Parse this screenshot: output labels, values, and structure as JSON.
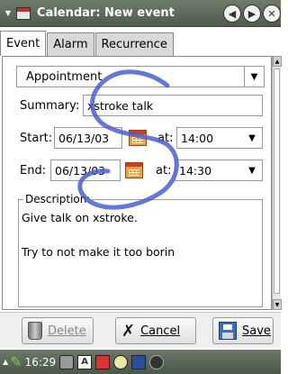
{
  "window": {
    "title": "Calendar: New event",
    "accent": "#5a6756"
  },
  "tabs": [
    {
      "label": "Event",
      "active": true
    },
    {
      "label": "Alarm",
      "active": false
    },
    {
      "label": "Recurrence",
      "active": false
    }
  ],
  "form": {
    "category": "Appointment",
    "summary_label": "Summary:",
    "summary_value": "xstroke talk",
    "start_label": "Start:",
    "start_date": "06/13/03",
    "start_at_label": "at:",
    "start_time": "14:00",
    "end_label": "End:",
    "end_date": "06/13/03",
    "end_at_label": "at:",
    "end_time": "14:30",
    "description_label": "Description:",
    "description_text": "Give talk on xstroke.\n\nTry to not make it too borin"
  },
  "buttons": {
    "delete_label": "Delete",
    "cancel_label": "Cancel",
    "save_label": "Save"
  },
  "taskbar": {
    "time": "16:29"
  },
  "icons": {
    "window_menu": "triangle-down-icon",
    "app": "calendar-icon",
    "nav_back": "arrow-left-icon",
    "nav_forward": "arrow-right-icon",
    "close": "close-icon",
    "date_picker": "calendar-icon",
    "delete": "trash-icon",
    "cancel": "x-icon",
    "save": "floppy-icon"
  }
}
